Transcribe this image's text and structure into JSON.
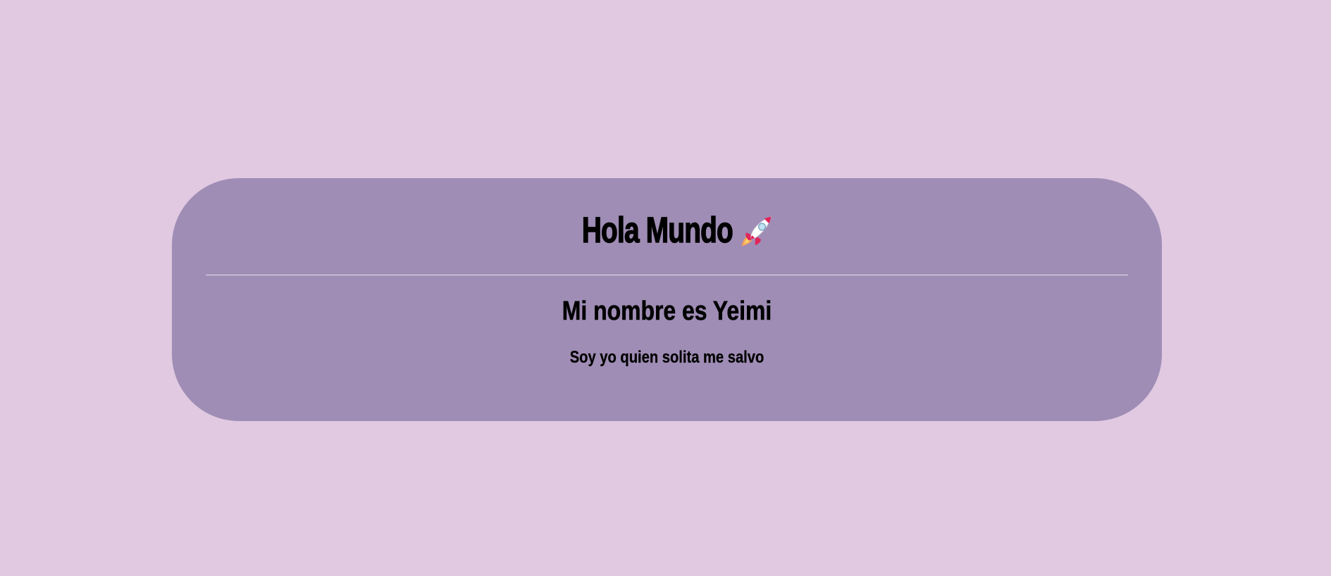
{
  "page": {
    "background_color": "#e0c9e1",
    "card_color": "#9f8db5",
    "divider_color": "#e6dff0"
  },
  "card": {
    "title": "Hola Mundo",
    "title_icon": "rocket-icon",
    "subtitle": "Mi nombre es Yeimi",
    "tagline": "Soy yo quien solita me salvo"
  }
}
